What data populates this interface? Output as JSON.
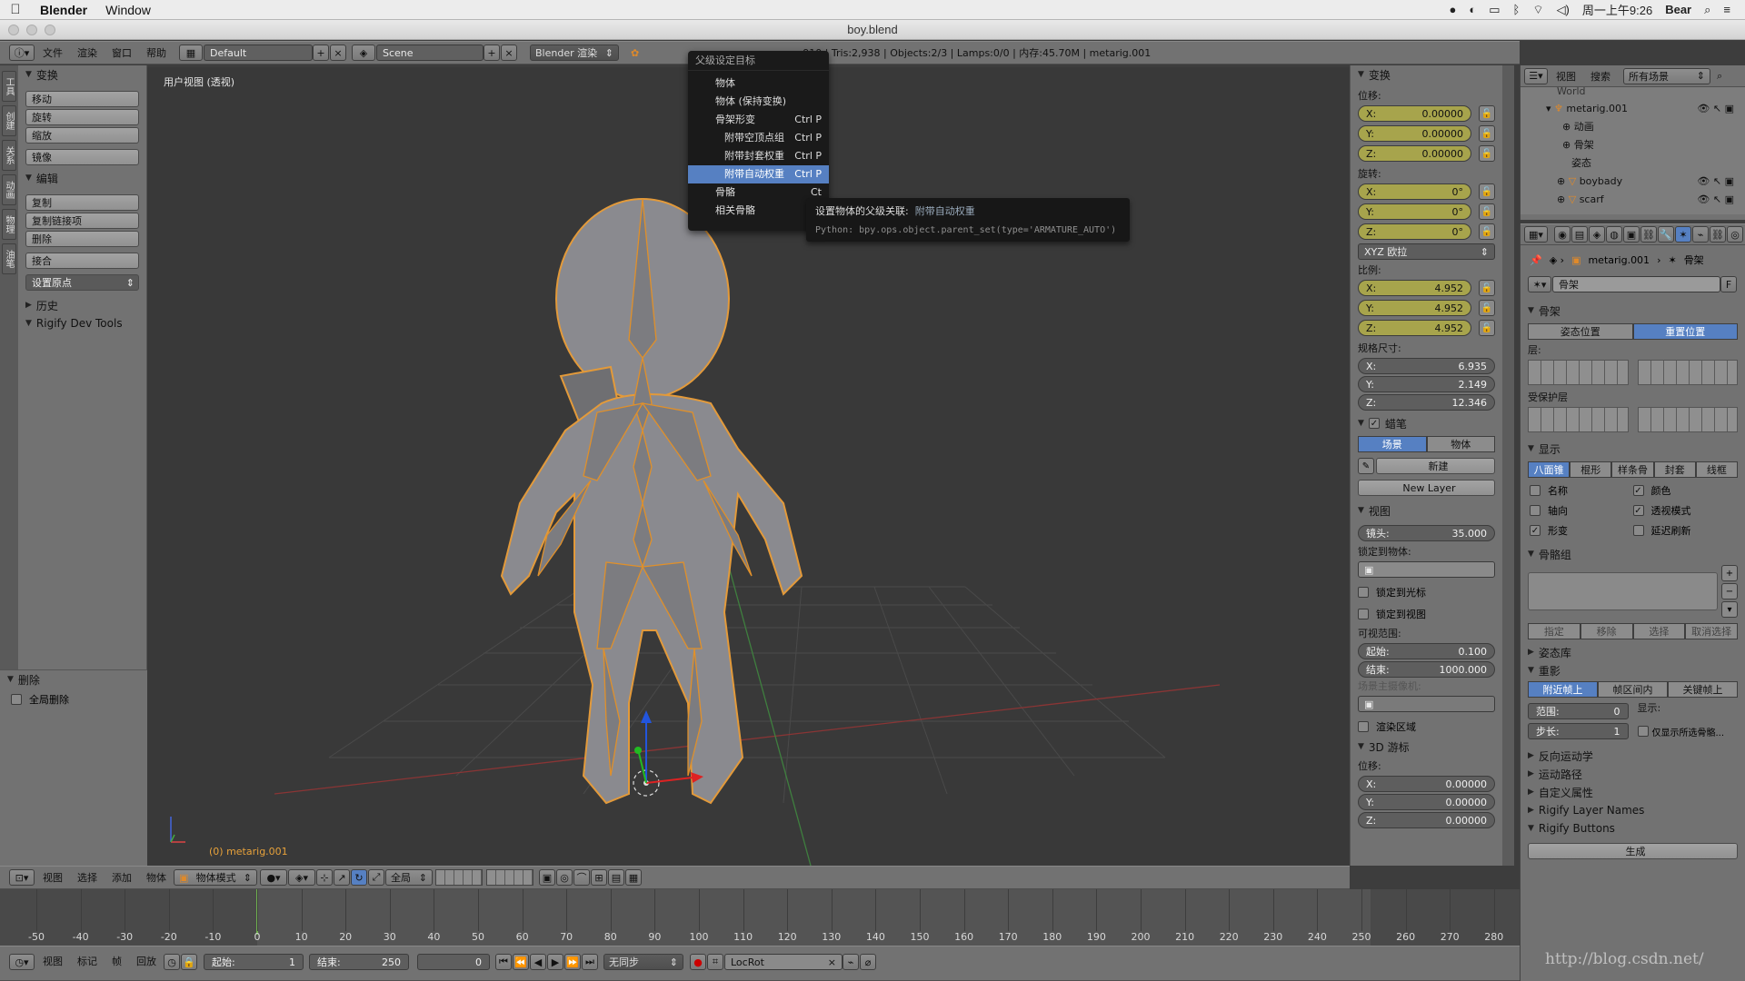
{
  "mac_menubar": {
    "app": "Blender",
    "menu_window": "Window",
    "status_right": [
      "周一上午9:26",
      "Bear"
    ]
  },
  "window": {
    "title": "boy.blend"
  },
  "info_header": {
    "menus": [
      "文件",
      "渲染",
      "窗口",
      "帮助"
    ],
    "screen_layout": "Default",
    "scene": "Scene",
    "render_engine": "Blender 渲染",
    "stats": "910 | Tris:2,938 | Objects:2/3 | Lamps:0/0 | 内存:45.70M | metarig.001"
  },
  "tool_shelf": {
    "transform_title": "变换",
    "transform_buttons": [
      "移动",
      "旋转",
      "缩放",
      "镜像"
    ],
    "edit_title": "编辑",
    "edit_buttons": [
      "复制",
      "复制链接项",
      "删除",
      "接合"
    ],
    "set_origin": "设置原点",
    "history_title": "历史",
    "rigify_title": "Rigify Dev Tools",
    "side_tabs": [
      "工具",
      "创建",
      "关系",
      "动画",
      "物理",
      "油笔"
    ],
    "delete_title": "删除",
    "global_delete": "全局删除"
  },
  "viewport": {
    "label": "用户视图 (透视)",
    "object_label": "(0) metarig.001"
  },
  "popup_menu": {
    "title": "父级设定目标",
    "items": [
      {
        "label": "物体",
        "shortcut": ""
      },
      {
        "label": "物体 (保持变换)",
        "shortcut": ""
      },
      {
        "label": "骨架形变",
        "shortcut": "Ctrl P"
      },
      {
        "label": "附带空顶点组",
        "shortcut": "Ctrl P"
      },
      {
        "label": "附带封套权重",
        "shortcut": "Ctrl P"
      },
      {
        "label": "附带自动权重",
        "shortcut": "Ctrl P"
      },
      {
        "label": "骨骼",
        "shortcut": "Ct"
      },
      {
        "label": "相关骨骼",
        "shortcut": "C"
      }
    ],
    "highlighted_index": 5
  },
  "tooltip": {
    "title": "设置物体的父级关联:",
    "value": "附带自动权重",
    "python": "Python: bpy.ops.object.parent_set(type='ARMATURE_AUTO')"
  },
  "properties_n": {
    "transform_title": "变换",
    "location_label": "位移:",
    "location": [
      {
        "axis": "X:",
        "value": "0.00000"
      },
      {
        "axis": "Y:",
        "value": "0.00000"
      },
      {
        "axis": "Z:",
        "value": "0.00000"
      }
    ],
    "rotation_label": "旋转:",
    "rotation": [
      {
        "axis": "X:",
        "value": "0°"
      },
      {
        "axis": "Y:",
        "value": "0°"
      },
      {
        "axis": "Z:",
        "value": "0°"
      }
    ],
    "rotation_mode": "XYZ 欧拉",
    "scale_label": "比例:",
    "scale": [
      {
        "axis": "X:",
        "value": "4.952"
      },
      {
        "axis": "Y:",
        "value": "4.952"
      },
      {
        "axis": "Z:",
        "value": "4.952"
      }
    ],
    "dimensions_label": "规格尺寸:",
    "dimensions": [
      {
        "axis": "X:",
        "value": "6.935"
      },
      {
        "axis": "Y:",
        "value": "2.149"
      },
      {
        "axis": "Z:",
        "value": "12.346"
      }
    ],
    "grease_title": "蜡笔",
    "grease_seg": [
      "场景",
      "物体"
    ],
    "grease_new": "新建",
    "new_layer": "New Layer",
    "view_title": "视图",
    "lens_label": "镜头:",
    "lens_value": "35.000",
    "lock_to_object": "锁定到物体:",
    "lock_to_cursor": "锁定到光标",
    "lock_to_view": "锁定到视图",
    "clip_label": "可视范围:",
    "clip_start_label": "起始:",
    "clip_start": "0.100",
    "clip_end_label": "结束:",
    "clip_end": "1000.000",
    "local_camera": "场景主摄像机:",
    "render_border": "渲染区域",
    "cursor_title": "3D 游标",
    "cursor_location_label": "位移:",
    "cursor": [
      {
        "axis": "X:",
        "value": "0.00000"
      },
      {
        "axis": "Y:",
        "value": "0.00000"
      },
      {
        "axis": "Z:",
        "value": "0.00000"
      }
    ]
  },
  "outliner": {
    "menus": [
      "视图",
      "搜索"
    ],
    "filter": "所有场景",
    "items": [
      {
        "label": "World"
      },
      {
        "label": "metarig.001"
      },
      {
        "label": "动画"
      },
      {
        "label": "骨架"
      },
      {
        "label": "姿态"
      },
      {
        "label": "boybady"
      },
      {
        "label": "scarf"
      }
    ]
  },
  "properties": {
    "breadcrumb": [
      "metarig.001",
      "骨架"
    ],
    "datablock": "骨架",
    "datablock_f": "F",
    "skeleton_title": "骨架",
    "pose_seg": [
      "姿态位置",
      "重置位置"
    ],
    "layers_label": "层:",
    "protected_label": "受保护层",
    "display_title": "显示",
    "display_seg": [
      "八面锥",
      "棍形",
      "样条骨",
      "封套",
      "线框"
    ],
    "display_checks": [
      {
        "label": "名称",
        "checked": false
      },
      {
        "label": "颜色",
        "checked": true
      },
      {
        "label": "轴向",
        "checked": false
      },
      {
        "label": "透视模式",
        "checked": true
      },
      {
        "label": "形变",
        "checked": true
      },
      {
        "label": "延迟刷新",
        "checked": false
      }
    ],
    "bone_groups_title": "骨骼组",
    "bone_group_buttons": [
      "指定",
      "移除",
      "选择",
      "取消选择"
    ],
    "pose_lib_title": "姿态库",
    "ghost_title": "重影",
    "ghost_seg": [
      "附近帧上",
      "帧区间内",
      "关键帧上"
    ],
    "range_label": "范围:",
    "range_value": "0",
    "step_label": "步长:",
    "step_value": "1",
    "display_label": "显示:",
    "only_selected": "仅显示所选骨骼...",
    "collapsed": [
      "反向运动学",
      "运动路径",
      "自定义属性",
      "Rigify Layer Names",
      "Rigify Buttons"
    ],
    "generate": "生成"
  },
  "viewport_header": {
    "menus": [
      "视图",
      "选择",
      "添加",
      "物体"
    ],
    "mode": "物体模式",
    "pivot": "全局"
  },
  "timeline": {
    "ticks": [
      "-50",
      "-40",
      "-30",
      "-20",
      "-10",
      "0",
      "10",
      "20",
      "30",
      "40",
      "50",
      "60",
      "70",
      "80",
      "90",
      "100",
      "110",
      "120",
      "130",
      "140",
      "150",
      "160",
      "170",
      "180",
      "190",
      "200",
      "210",
      "220",
      "230",
      "240",
      "250",
      "260",
      "270",
      "280"
    ],
    "current_frame_marker": 0,
    "menus": [
      "视图",
      "标记",
      "帧",
      "回放"
    ],
    "start_label": "起始:",
    "start": "1",
    "end_label": "结束:",
    "end": "250",
    "current": "0",
    "sync": "无同步",
    "keying_set": "LocRot"
  },
  "watermark": "http://blog.csdn.net/"
}
